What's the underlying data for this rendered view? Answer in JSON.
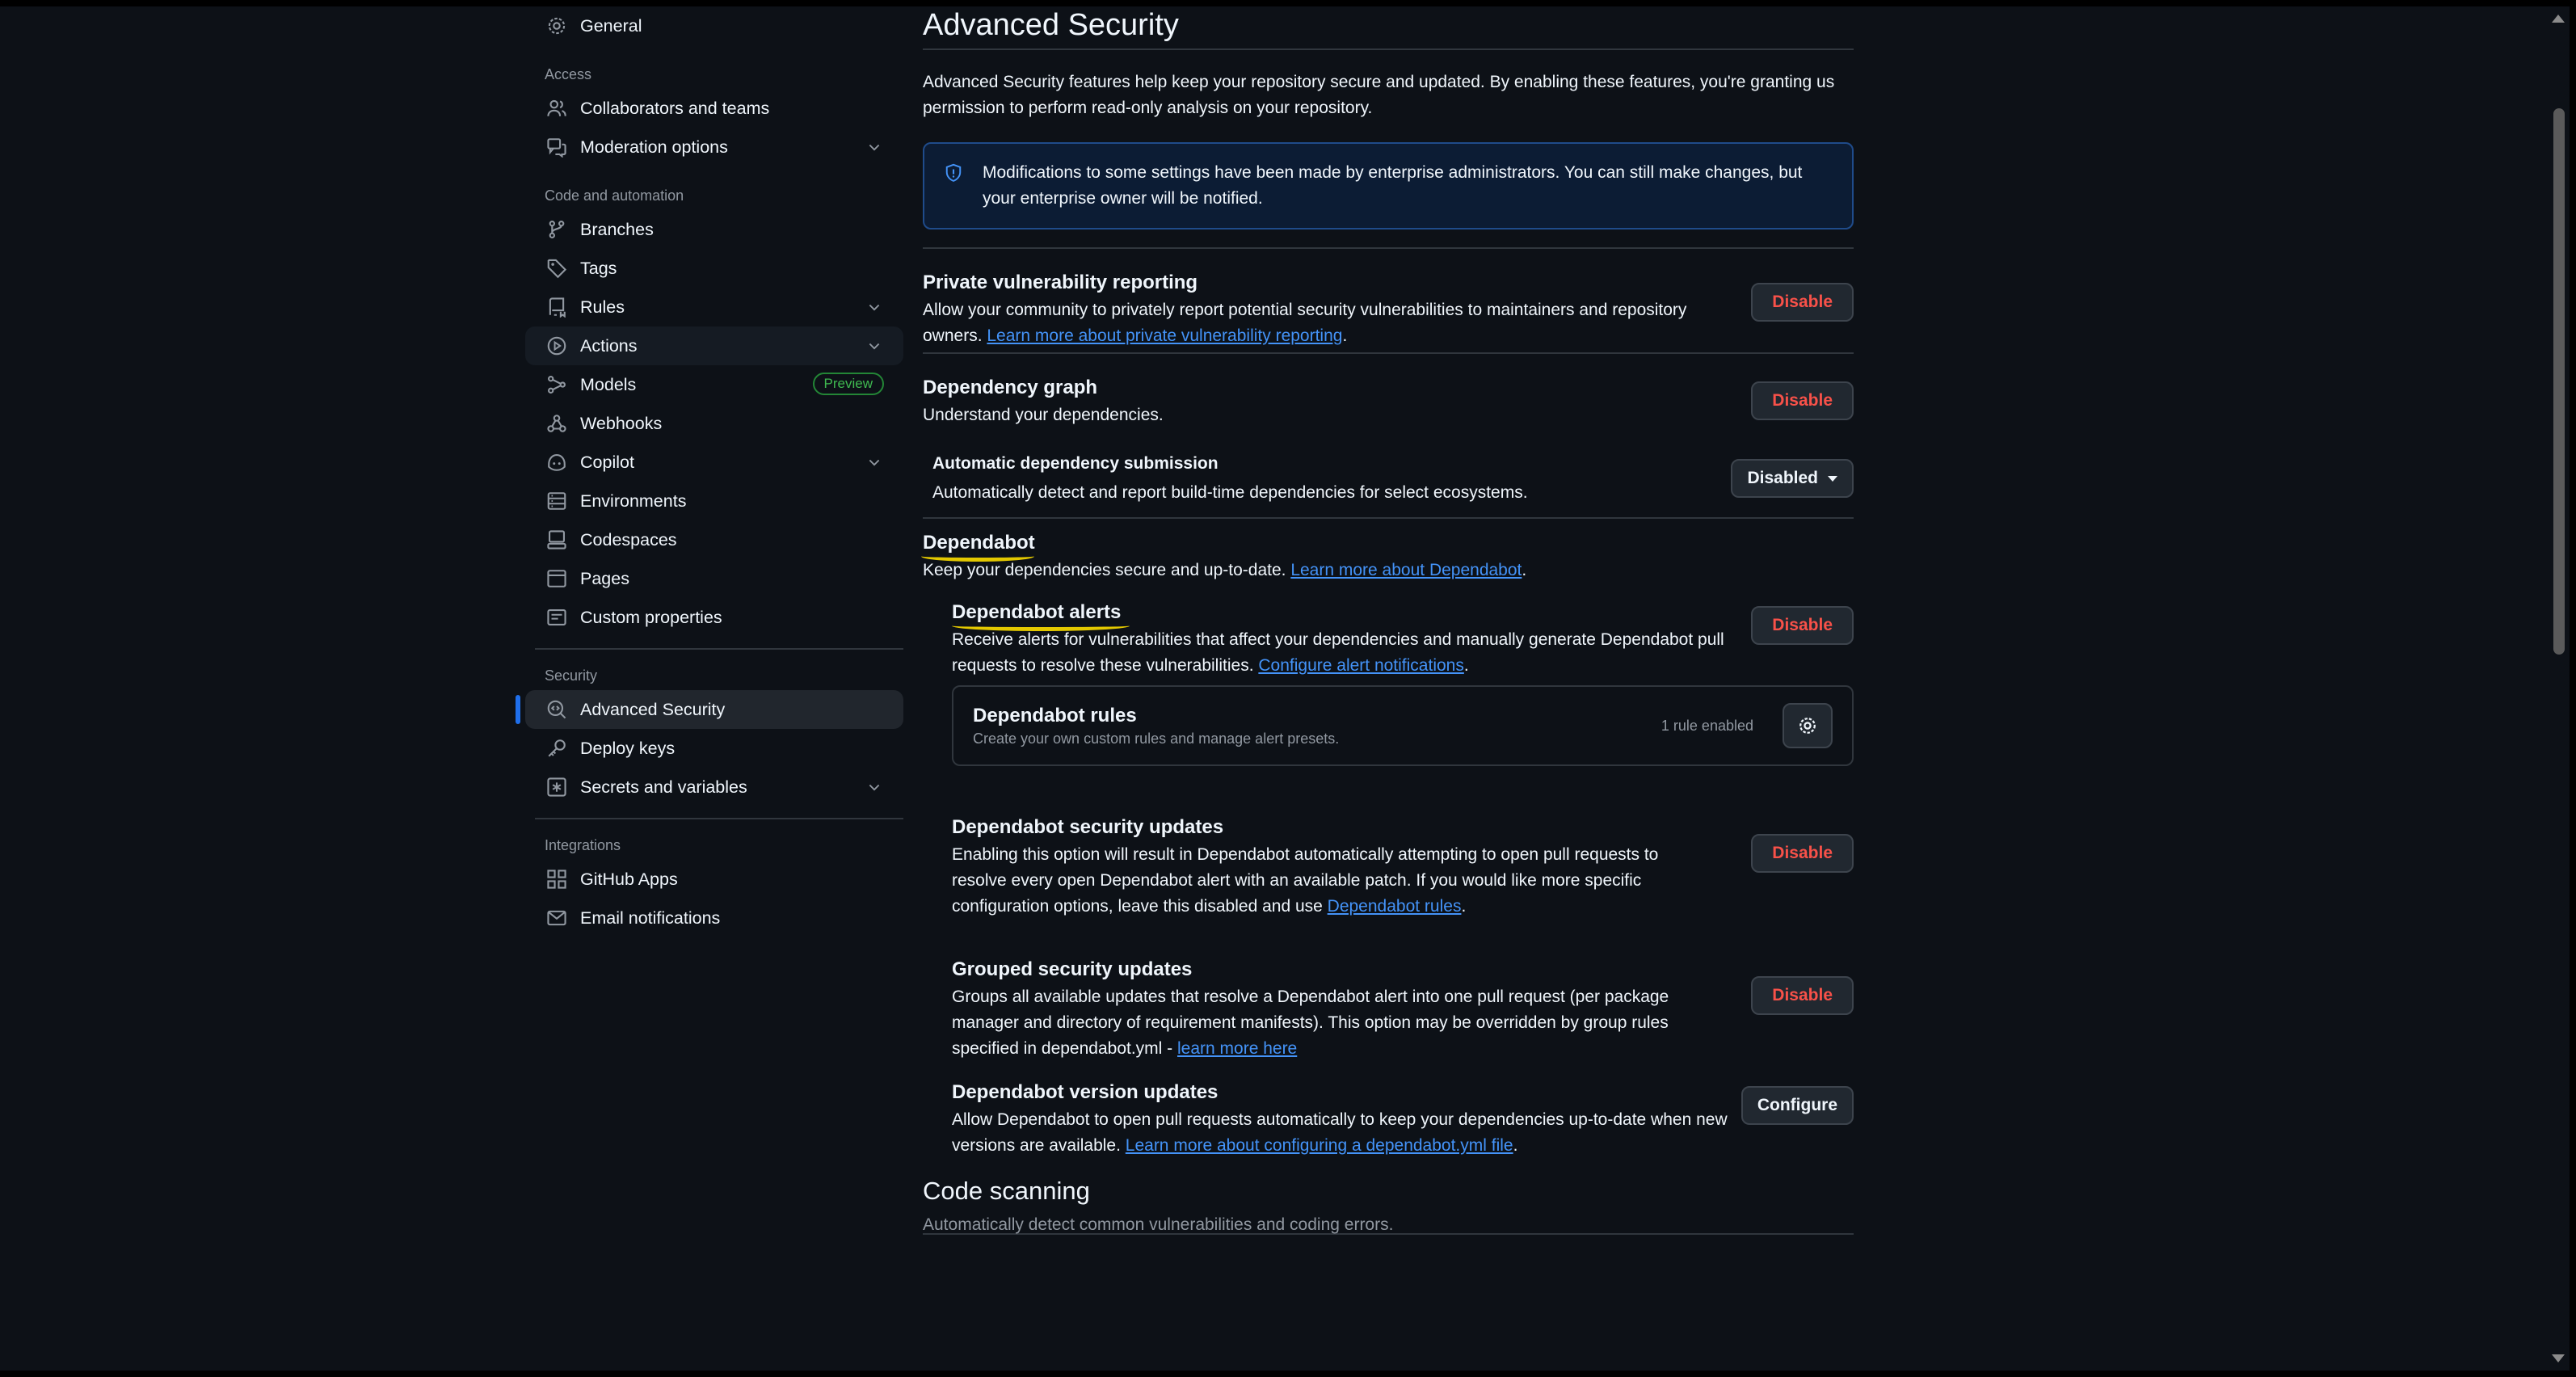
{
  "sidebar": {
    "general": "General",
    "access_title": "Access",
    "collaborators": "Collaborators and teams",
    "moderation": "Moderation options",
    "code_title": "Code and automation",
    "branches": "Branches",
    "tags": "Tags",
    "rules": "Rules",
    "actions": "Actions",
    "models": "Models",
    "models_badge": "Preview",
    "webhooks": "Webhooks",
    "copilot": "Copilot",
    "environments": "Environments",
    "codespaces": "Codespaces",
    "pages": "Pages",
    "custom_properties": "Custom properties",
    "security_title": "Security",
    "advanced_security": "Advanced Security",
    "deploy_keys": "Deploy keys",
    "secrets": "Secrets and variables",
    "integrations_title": "Integrations",
    "github_apps": "GitHub Apps",
    "email_notifications": "Email notifications"
  },
  "main": {
    "title": "Advanced Security",
    "intro": "Advanced Security features help keep your repository secure and updated. By enabling these features, you're granting us permission to perform read-only analysis on your repository.",
    "notice": "Modifications to some settings have been made by enterprise administrators. You can still make changes, but your enterprise owner will be notified.",
    "pvr": {
      "title": "Private vulnerability reporting",
      "desc": "Allow your community to privately report potential security vulnerabilities to maintainers and repository owners. ",
      "link": "Learn more about private vulnerability reporting",
      "button": "Disable"
    },
    "depgraph": {
      "title": "Dependency graph",
      "desc": "Understand your dependencies.",
      "button": "Disable"
    },
    "autodep": {
      "title": "Automatic dependency submission",
      "desc": "Automatically detect and report build-time dependencies for select ecosystems.",
      "button": "Disabled"
    },
    "dependabot": {
      "title": "Dependabot",
      "desc": "Keep your dependencies secure and up-to-date. ",
      "link": "Learn more about Dependabot"
    },
    "alerts": {
      "title": "Dependabot alerts",
      "desc": "Receive alerts for vulnerabilities that affect your dependencies and manually generate Dependabot pull requests to resolve these vulnerabilities. ",
      "link": "Configure alert notifications",
      "button": "Disable"
    },
    "rules": {
      "title": "Dependabot rules",
      "desc": "Create your own custom rules and manage alert presets.",
      "count": "1 rule enabled"
    },
    "security_updates": {
      "title": "Dependabot security updates",
      "desc": "Enabling this option will result in Dependabot automatically attempting to open pull requests to resolve every open Dependabot alert with an available patch. If you would like more specific configuration options, leave this disabled and use ",
      "link": "Dependabot rules",
      "button": "Disable"
    },
    "grouped": {
      "title": "Grouped security updates",
      "desc": "Groups all available updates that resolve a Dependabot alert into one pull request (per package manager and directory of requirement manifests). This option may be overridden by group rules specified in dependabot.yml - ",
      "link": "learn more here",
      "button": "Disable"
    },
    "version_updates": {
      "title": "Dependabot version updates",
      "desc": "Allow Dependabot to open pull requests automatically to keep your dependencies up-to-date when new versions are available. ",
      "link": "Learn more about configuring a dependabot.yml file",
      "button": "Configure"
    },
    "code_scanning": {
      "title": "Code scanning",
      "desc": "Automatically detect common vulnerabilities and coding errors."
    }
  },
  "colors": {
    "background": "#0d1117",
    "accent": "#1f6feb",
    "danger": "#f85149",
    "link": "#4493f8",
    "highlight": "#e3c800"
  }
}
